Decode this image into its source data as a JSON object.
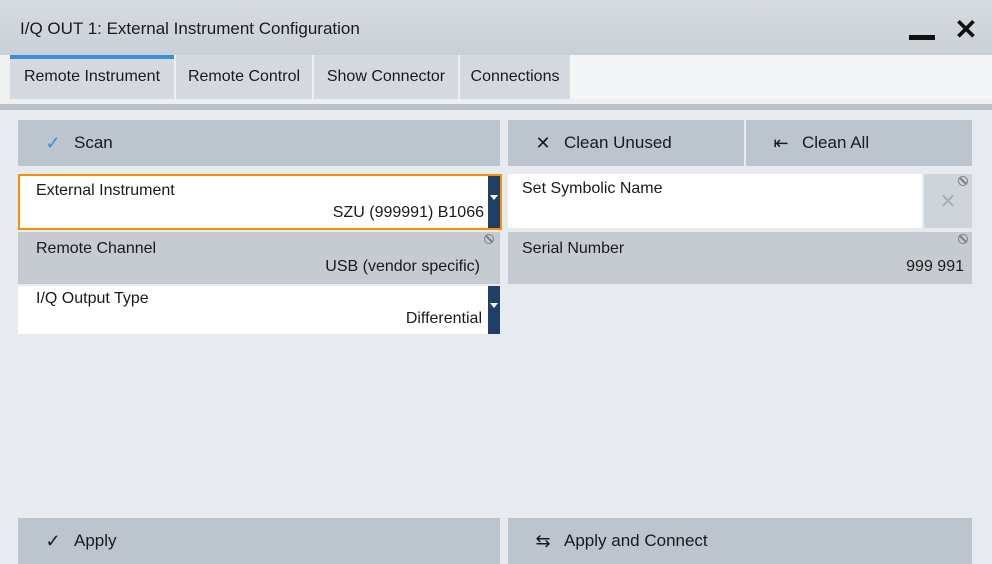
{
  "window": {
    "title": "I/Q OUT 1: External Instrument Configuration",
    "minimize_icon": "minimize-icon",
    "close_label": "✕"
  },
  "tabs": [
    {
      "label": "Remote Instrument",
      "active": true
    },
    {
      "label": "Remote Control",
      "active": false
    },
    {
      "label": "Show Connector",
      "active": false
    },
    {
      "label": "Connections",
      "active": false
    }
  ],
  "toolbar": {
    "scan": {
      "icon": "✓",
      "label": "Scan"
    },
    "clean_unused": {
      "icon": "✕",
      "label": "Clean Unused"
    },
    "clean_all": {
      "icon": "⇤",
      "label": "Clean All"
    }
  },
  "fields": {
    "external_instrument": {
      "label": "External Instrument",
      "value": "SZU (999991) B1066"
    },
    "remote_channel": {
      "label": "Remote Channel",
      "value": "USB (vendor specific)"
    },
    "iq_output_type": {
      "label": "I/Q Output Type",
      "value": "Differential"
    },
    "symbolic_name": {
      "label": "Set Symbolic Name",
      "value": "",
      "clear_icon": "✕"
    },
    "serial_number": {
      "label": "Serial Number",
      "value": "999 991"
    }
  },
  "footer": {
    "apply": {
      "icon": "✓",
      "label": "Apply"
    },
    "apply_connect": {
      "icon": "⇆",
      "label": "Apply and Connect"
    }
  },
  "colors": {
    "focus_border": "#f39200",
    "active_tab_indicator": "#3a8fd8",
    "dropdown_arrow": "#1f3f66"
  }
}
